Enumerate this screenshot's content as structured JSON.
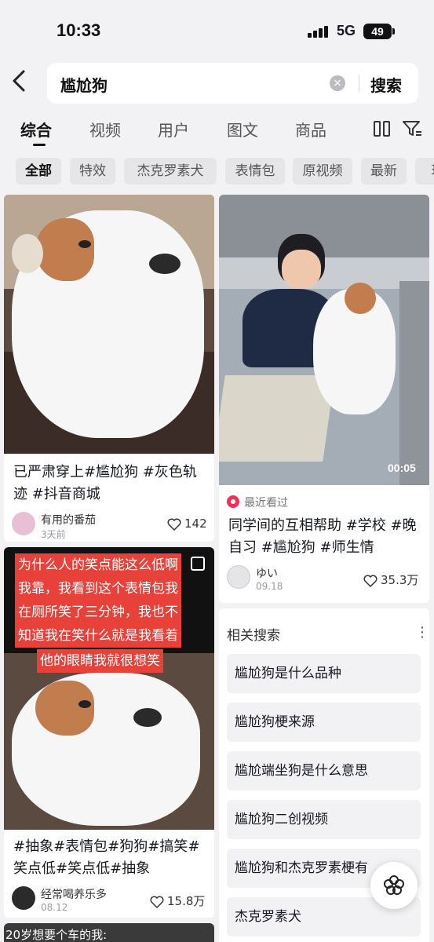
{
  "status_bar": {
    "time": "10:33",
    "network": "5G",
    "battery": "49"
  },
  "search": {
    "query": "尴尬狗",
    "submit_label": "搜索"
  },
  "tabs": [
    "综合",
    "视频",
    "用户",
    "图文",
    "商品"
  ],
  "chips": [
    "全部",
    "特效",
    "杰克罗素犬",
    "表情包",
    "原视频",
    "最新",
    "玩"
  ],
  "cards": [
    {
      "title_lines": [
        "已严肃穿上#尴尬狗 #灰色轨",
        "迹 #抖音商城"
      ],
      "author": "有用的番茄",
      "date": "3天前",
      "likes": "142"
    },
    {
      "duration": "00:05",
      "recent_label": "最近看过",
      "title_lines": [
        "同学间的互相帮助 #学校 #晚",
        "自习 #尴尬狗 #师生情"
      ],
      "author": "ゆい",
      "date": "09.18",
      "likes": "35.3万"
    },
    {
      "caption_lines": [
        "为什么人的笑点能这么低啊",
        "我靠，我看到这个表情包我",
        "在厕所笑了三分钟，我也不",
        "知道我在笑什么就是我看着",
        "他的眼睛我就很想笑"
      ],
      "title_lines": [
        "#抽象#表情包#狗狗#搞笑#",
        "笑点低#笑点低#抽象"
      ],
      "author": "经常喝养乐多",
      "date": "08.12",
      "likes": "15.8万"
    },
    {
      "caption_partial": "20岁想要个车的我:"
    }
  ],
  "related": {
    "heading": "相关搜索",
    "items": [
      "尴尬狗是什么品种",
      "尴尬狗梗来源",
      "尴尬端坐狗是什么意思",
      "尴尬狗二创视频",
      "尴尬狗和杰克罗素梗有",
      "杰克罗素犬"
    ]
  },
  "colors": {
    "accent_red": "#e8413a",
    "recent_pink": "#fe2c55"
  }
}
